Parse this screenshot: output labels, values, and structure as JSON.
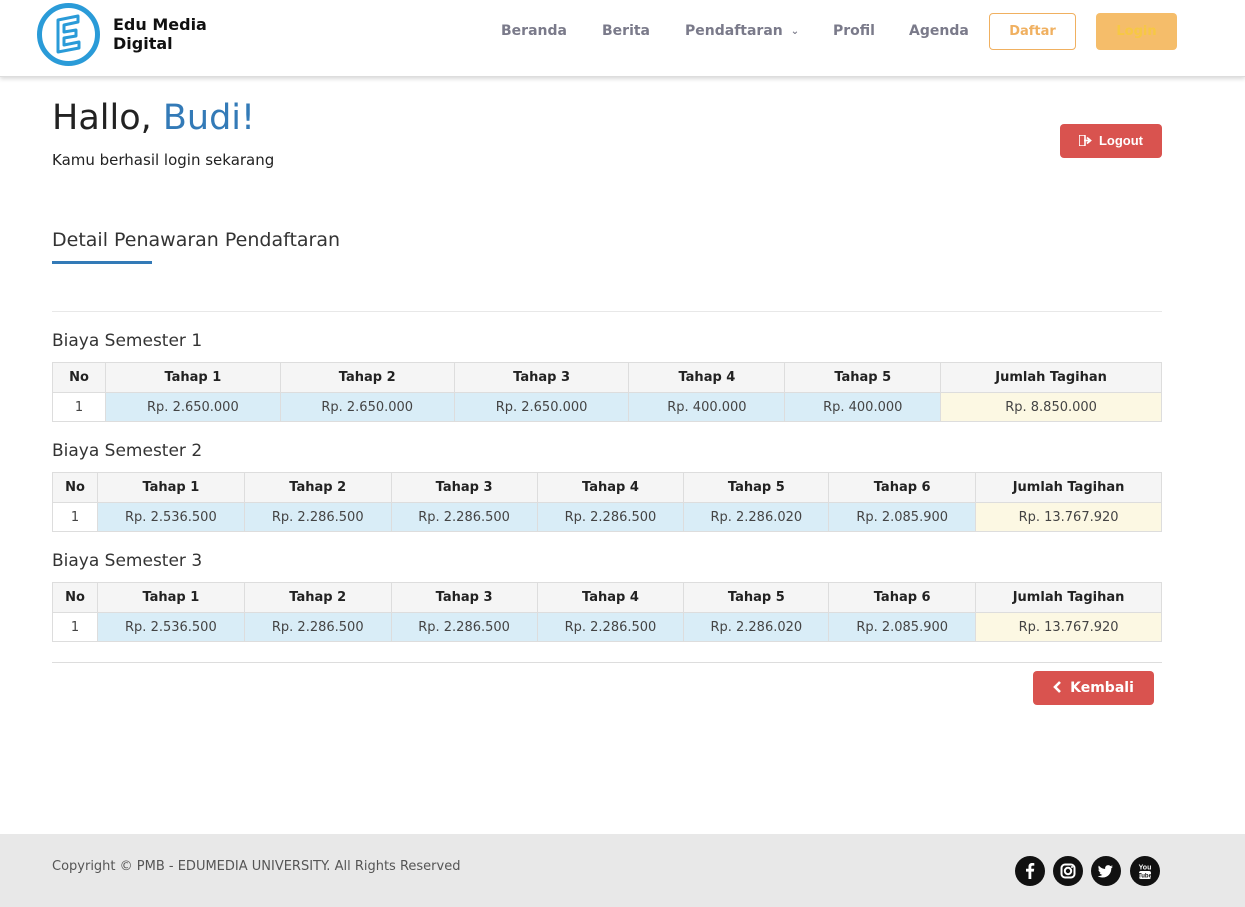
{
  "header": {
    "brand_line1": "Edu Media",
    "brand_line2": "Digital",
    "nav": {
      "beranda": "Beranda",
      "berita": "Berita",
      "pendaftaran": "Pendaftaran",
      "profil": "Profil",
      "agenda": "Agenda"
    },
    "daftar_label": "Daftar",
    "login_label": "Login"
  },
  "greeting": {
    "hello": "Hallo, ",
    "name": "Budi!",
    "subtitle": "Kamu berhasil login sekarang"
  },
  "logout_label": "Logout",
  "section_title": "Detail Penawaran Pendaftaran",
  "semesters": [
    {
      "title": "Biaya Semester 1",
      "headers": [
        "No",
        "Tahap 1",
        "Tahap 2",
        "Tahap 3",
        "Tahap 4",
        "Tahap 5",
        "Jumlah Tagihan"
      ],
      "row": [
        "1",
        "Rp. 2.650.000",
        "Rp. 2.650.000",
        "Rp. 2.650.000",
        "Rp. 400.000",
        "Rp. 400.000",
        "Rp. 8.850.000"
      ]
    },
    {
      "title": "Biaya Semester 2",
      "headers": [
        "No",
        "Tahap 1",
        "Tahap 2",
        "Tahap 3",
        "Tahap 4",
        "Tahap 5",
        "Tahap 6",
        "Jumlah Tagihan"
      ],
      "row": [
        "1",
        "Rp. 2.536.500",
        "Rp. 2.286.500",
        "Rp. 2.286.500",
        "Rp. 2.286.500",
        "Rp. 2.286.020",
        "Rp. 2.085.900",
        "Rp. 13.767.920"
      ]
    },
    {
      "title": "Biaya Semester 3",
      "headers": [
        "No",
        "Tahap 1",
        "Tahap 2",
        "Tahap 3",
        "Tahap 4",
        "Tahap 5",
        "Tahap 6",
        "Jumlah Tagihan"
      ],
      "row": [
        "1",
        "Rp. 2.536.500",
        "Rp. 2.286.500",
        "Rp. 2.286.500",
        "Rp. 2.286.500",
        "Rp. 2.286.020",
        "Rp. 2.085.900",
        "Rp. 13.767.920"
      ]
    }
  ],
  "kembali_label": "Kembali",
  "footer": {
    "copyright": "Copyright © PMB - EDUMEDIA UNIVERSITY. All Rights Reserved",
    "social": [
      "facebook-icon",
      "instagram-icon",
      "twitter-icon",
      "youtube-icon"
    ]
  },
  "colors": {
    "accent_blue": "#337ab7",
    "danger_red": "#d9534f",
    "login_orange": "#f5bd6a",
    "step_cell": "#d9edf7",
    "total_cell": "#fcf8e3"
  }
}
